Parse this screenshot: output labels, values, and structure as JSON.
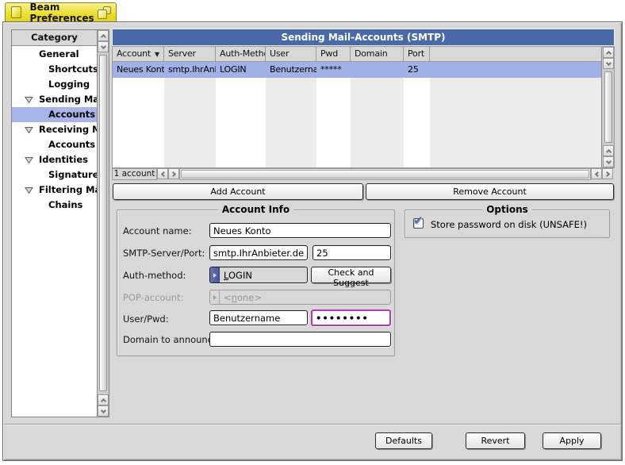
{
  "window": {
    "title": "Beam Preferences"
  },
  "colors": {
    "titlebar_yellow": "#ece13e",
    "panel_gray": "#d8d8d8",
    "header_blue": "#4a69a8",
    "selection_blue": "#9fb1e6",
    "focus_purple": "#b03ab0",
    "menu_accent_indigo": "#5a64a8",
    "check_indigo": "#5767b5"
  },
  "icons": {
    "checkmark": "✔",
    "sort_descending": "▼"
  },
  "sidebar": {
    "header": "Category",
    "items": [
      {
        "label": "General",
        "indent": 0,
        "expander": false,
        "selected": false
      },
      {
        "label": "Shortcuts",
        "indent": 1,
        "expander": false,
        "selected": false
      },
      {
        "label": "Logging",
        "indent": 1,
        "expander": false,
        "selected": false
      },
      {
        "label": "Sending Mail",
        "indent": 0,
        "expander": true,
        "selected": false
      },
      {
        "label": "Accounts",
        "indent": 1,
        "expander": false,
        "selected": true
      },
      {
        "label": "Receiving Mail",
        "indent": 0,
        "expander": true,
        "selected": false
      },
      {
        "label": "Accounts",
        "indent": 1,
        "expander": false,
        "selected": false
      },
      {
        "label": "Identities",
        "indent": 0,
        "expander": true,
        "selected": false
      },
      {
        "label": "Signatures",
        "indent": 1,
        "expander": false,
        "selected": false
      },
      {
        "label": "Filtering Mail",
        "indent": 0,
        "expander": true,
        "selected": false
      },
      {
        "label": "Chains",
        "indent": 1,
        "expander": false,
        "selected": false
      }
    ]
  },
  "main": {
    "title": "Sending Mail-Accounts (SMTP)",
    "table": {
      "columns": [
        "Account",
        "Server",
        "Auth-Method",
        "User",
        "Pwd",
        "Domain",
        "Port",
        ""
      ],
      "sort_column": "Account",
      "rows": [
        {
          "account": "Neues Konto",
          "server": "smtp.IhrAnbieter.",
          "auth_method": "LOGIN",
          "user": "Benutzername",
          "pwd": "*****",
          "domain": "",
          "port": "25"
        }
      ],
      "status": "1 account"
    },
    "add_button": "Add Account",
    "remove_button": "Remove Account",
    "account_info": {
      "legend": "Account Info",
      "account_name": {
        "label": "Account name:",
        "value": "Neues Konto"
      },
      "smtp": {
        "label": "SMTP-Server/Port:",
        "server": "smtp.IhrAnbieter.de",
        "port": "25"
      },
      "auth": {
        "label": "Auth-method:",
        "value_parts": [
          "L",
          "OGIN"
        ],
        "check_button": "Check and Suggest"
      },
      "pop": {
        "label": "POP-account:",
        "value_parts": [
          "<",
          "n",
          "one>"
        ],
        "disabled": true
      },
      "userpwd": {
        "label": "User/Pwd:",
        "user": "Benutzername",
        "pwd_display": "••••••••"
      },
      "domain": {
        "label": "Domain to announce:",
        "value": ""
      }
    },
    "options": {
      "legend": "Options",
      "store_password": {
        "label": "Store password on disk (UNSAFE!)",
        "checked": true
      }
    }
  },
  "footer": {
    "defaults": "Defaults",
    "revert": "Revert",
    "apply": "Apply"
  }
}
